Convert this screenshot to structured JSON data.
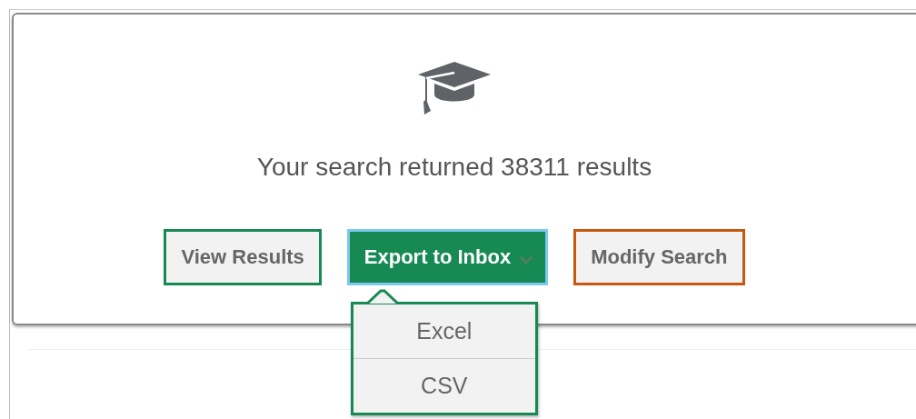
{
  "result_message": "Your search returned 38311 results",
  "buttons": [
    {
      "label": "View Results",
      "kind": "default",
      "color": "#168a52",
      "has_dropdown": false
    },
    {
      "label": "Export to Inbox",
      "kind": "primary",
      "color": "#7cc8ee",
      "has_dropdown": true
    },
    {
      "label": "Modify Search",
      "kind": "default",
      "color": "#c8570f",
      "has_dropdown": false
    }
  ],
  "dropdown": {
    "items": [
      "Excel",
      "CSV"
    ]
  }
}
